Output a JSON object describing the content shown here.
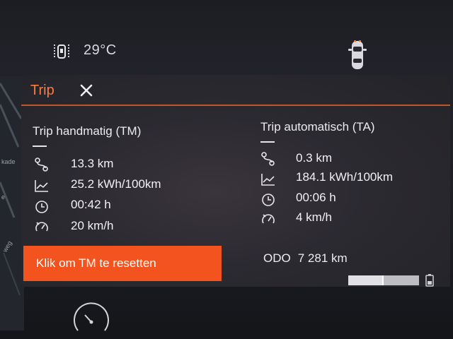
{
  "status": {
    "temperature": "29°C"
  },
  "icons": {
    "door": "door-open-icon",
    "car": "car-top-view-icon",
    "close": "close-icon",
    "distance": "route-icon",
    "consumption": "consumption-chart-icon",
    "time": "clock-icon",
    "speed": "speedometer-icon",
    "battery": "battery-icon",
    "gauge": "gauge-icon"
  },
  "map": {
    "labels": [
      "kade",
      "e",
      "weg"
    ]
  },
  "panel": {
    "title": "Trip",
    "manual": {
      "title": "Trip handmatig (TM)",
      "distance": "13.3 km",
      "consumption": "25.2 kWh/100km",
      "duration": "00:42 h",
      "speed": "20 km/h"
    },
    "auto": {
      "title": "Trip automatisch (TA)",
      "distance": "0.3 km",
      "consumption": "184.1 kWh/100km",
      "duration": "00:06 h",
      "speed": "4 km/h"
    },
    "reset_label": "Klik om TM te resetten",
    "odo_label": "ODO",
    "odo_value": "7 281 km"
  },
  "colors": {
    "accent": "#ff7a3d",
    "button": "#f2531f",
    "divider": "#c2552a"
  }
}
